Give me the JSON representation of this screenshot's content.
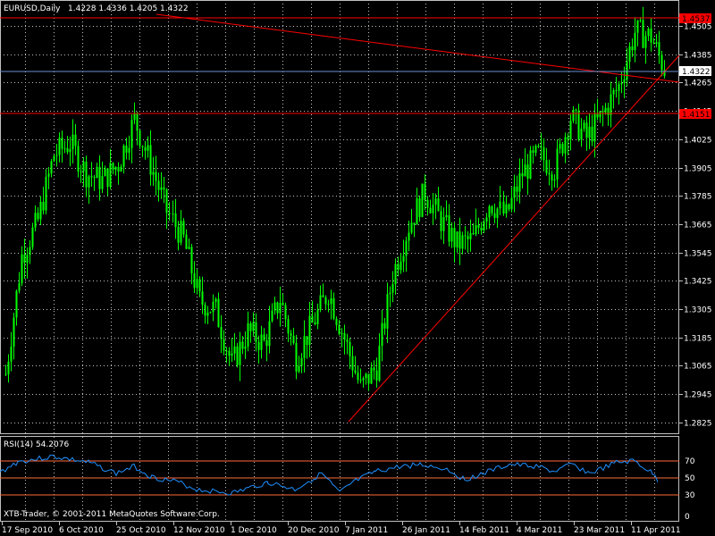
{
  "chart_header": {
    "symbol_timeframe": "EURUSD,Daily",
    "ohlc": "1.4228 1.4336 1.4205 1.4322"
  },
  "rsi_header": {
    "label": "RSI(14) 54.2076"
  },
  "copyright": "XTB-Trader, © 2001-2011 MetaQuotes Software Corp.",
  "price_axis": {
    "ticks": [
      "1.4505",
      "1.4385",
      "1.4265",
      "1.4145",
      "1.4025",
      "1.3905",
      "1.3785",
      "1.3665",
      "1.3545",
      "1.3425",
      "1.3305",
      "1.3185",
      "1.3065",
      "1.2945",
      "1.2825"
    ],
    "tick_values": [
      1.4505,
      1.4385,
      1.4265,
      1.4145,
      1.4025,
      1.3905,
      1.3785,
      1.3665,
      1.3545,
      1.3425,
      1.3305,
      1.3185,
      1.3065,
      1.2945,
      1.2825
    ]
  },
  "rsi_axis": {
    "ticks": [
      "70",
      "50",
      "30",
      "0"
    ],
    "tick_values": [
      70,
      50,
      30,
      0
    ]
  },
  "time_axis": {
    "labels": [
      "17 Sep 2010",
      "6 Oct 2010",
      "25 Oct 2010",
      "12 Nov 2010",
      "1 Dec 2010",
      "20 Dec 2010",
      "7 Jan 2011",
      "26 Jan 2011",
      "14 Feb 2011",
      "4 Mar 2011",
      "23 Mar 2011",
      "11 Apr 2011"
    ]
  },
  "levels": {
    "resistance": "1.4537",
    "current": "1.4322",
    "support": "1.4151"
  },
  "colors": {
    "background": "#000000",
    "grid": "#c0c0c0",
    "candle": "#00ff00",
    "trend_line": "#ff0000",
    "current_line": "#6a8fd0",
    "rsi_line": "#1e90ff",
    "rsi_level": "#ff6a3a"
  },
  "chart_data": {
    "type": "candlestick",
    "title": "EURUSD,Daily",
    "ylim": [
      1.279,
      1.46
    ],
    "x_start": "17 Sep 2010",
    "x_end": "15 Apr 2011",
    "close_path": [
      [
        0,
        1.303
      ],
      [
        6,
        1.353
      ],
      [
        12,
        1.368
      ],
      [
        18,
        1.396
      ],
      [
        24,
        1.401
      ],
      [
        30,
        1.388
      ],
      [
        36,
        1.385
      ],
      [
        42,
        1.392
      ],
      [
        48,
        1.411
      ],
      [
        54,
        1.392
      ],
      [
        60,
        1.372
      ],
      [
        66,
        1.36
      ],
      [
        72,
        1.334
      ],
      [
        78,
        1.33
      ],
      [
        84,
        1.307
      ],
      [
        90,
        1.321
      ],
      [
        96,
        1.316
      ],
      [
        102,
        1.335
      ],
      [
        108,
        1.31
      ],
      [
        114,
        1.324
      ],
      [
        120,
        1.338
      ],
      [
        126,
        1.318
      ],
      [
        132,
        1.297
      ],
      [
        138,
        1.306
      ],
      [
        144,
        1.345
      ],
      [
        150,
        1.366
      ],
      [
        156,
        1.38
      ],
      [
        162,
        1.368
      ],
      [
        168,
        1.358
      ],
      [
        174,
        1.36
      ],
      [
        180,
        1.376
      ],
      [
        186,
        1.37
      ],
      [
        192,
        1.388
      ],
      [
        198,
        1.396
      ],
      [
        204,
        1.39
      ],
      [
        210,
        1.412
      ],
      [
        216,
        1.403
      ],
      [
        222,
        1.413
      ],
      [
        228,
        1.425
      ],
      [
        234,
        1.448
      ],
      [
        240,
        1.446
      ],
      [
        245,
        1.4322
      ]
    ],
    "series": [
      {
        "name": "RSI(14)",
        "last": 54.2076
      }
    ],
    "levels": [
      1.4537,
      1.4322,
      1.4151
    ],
    "rsi_levels": [
      70,
      50,
      30
    ]
  }
}
